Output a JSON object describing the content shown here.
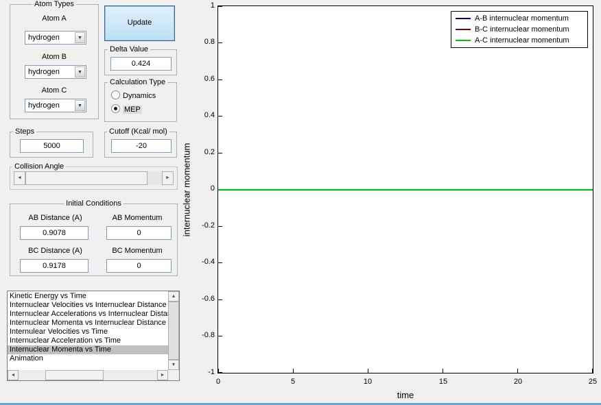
{
  "icons": {
    "dropdown_arrow": "▼",
    "arrow_left": "◄",
    "arrow_right": "►",
    "arrow_up": "▲",
    "arrow_down": "▼"
  },
  "atom_types": {
    "title": "Atom Types",
    "atom_a": {
      "label": "Atom A",
      "value": "hydrogen"
    },
    "atom_b": {
      "label": "Atom B",
      "value": "hydrogen"
    },
    "atom_c": {
      "label": "Atom C",
      "value": "hydrogen"
    }
  },
  "update_button": {
    "label": "Update"
  },
  "delta_value": {
    "title": "Delta Value",
    "value": "0.424"
  },
  "calculation_type": {
    "title": "Calculation Type",
    "options": [
      {
        "label": "Dynamics",
        "selected": false
      },
      {
        "label": "MEP",
        "selected": true
      }
    ]
  },
  "steps": {
    "title": "Steps",
    "value": "5000"
  },
  "cutoff": {
    "title": "Cutoff (Kcal/ mol)",
    "value": "-20"
  },
  "collision_angle": {
    "title": "Collision Angle"
  },
  "initial_conditions": {
    "title": "Initial Conditions",
    "ab_distance": {
      "label": "AB Distance (A)",
      "value": "0.9078"
    },
    "ab_momentum": {
      "label": "AB Momentum",
      "value": "0"
    },
    "bc_distance": {
      "label": "BC Distance (A)",
      "value": "0.9178"
    },
    "bc_momentum": {
      "label": "BC Momentum",
      "value": "0"
    }
  },
  "plot_list": {
    "items": [
      "Kinetic Energy vs Time",
      "Internuclear Velocities vs Internuclear Distance",
      "Internuclear Accelerations vs Internuclear Distance",
      "Internuclear Momenta vs Internuclear Distance",
      "Internulear Velocities vs Time",
      "Internuclear Acceleration vs Time",
      "Internuclear Momenta vs Time",
      "Animation"
    ],
    "selected_index": 6,
    "selected_item": "Internuclear Momenta vs Time"
  },
  "chart_data": {
    "type": "line",
    "title": "",
    "xlabel": "time",
    "ylabel": "internuclear momentum",
    "xlim": [
      0,
      25
    ],
    "ylim": [
      -1,
      1
    ],
    "xticks": [
      "0",
      "5",
      "10",
      "15",
      "20",
      "25"
    ],
    "yticks": [
      "1",
      "0.8",
      "0.6",
      "0.4",
      "0.2",
      "0",
      "-0.2",
      "-0.4",
      "-0.6",
      "-0.8",
      "-1"
    ],
    "grid": false,
    "legend_position": "top-right",
    "x": [
      0,
      25
    ],
    "series": [
      {
        "name": "A-B internuclear momentum",
        "color": "#000080",
        "values": [
          0,
          0
        ]
      },
      {
        "name": "B-C internuclear momentum",
        "color": "#800000",
        "values": [
          0,
          0
        ]
      },
      {
        "name": "A-C internuclear momentum",
        "color": "#00c400",
        "values": [
          0,
          0
        ]
      }
    ]
  }
}
